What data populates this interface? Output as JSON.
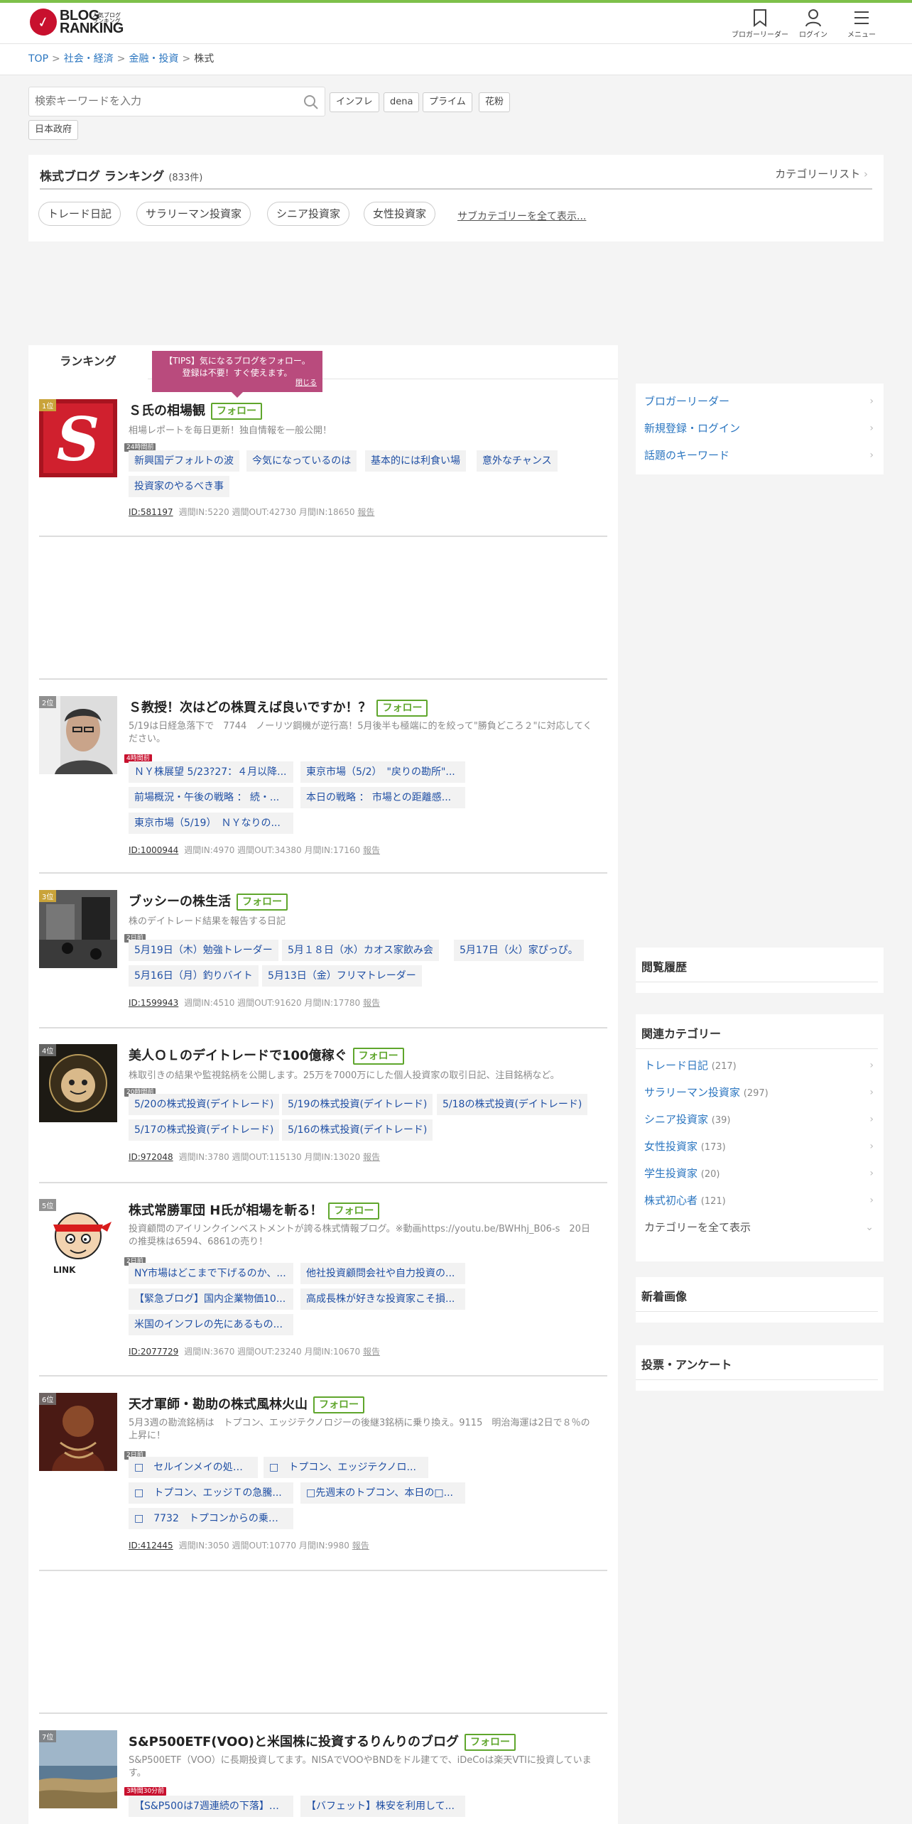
{
  "header": {
    "logo_line1": "BLOG",
    "logo_line2": "RANKING",
    "logo_sub": "人気ブログランキング",
    "nav": [
      {
        "label": "ブロガーリーダー",
        "icon": "bookmark-icon"
      },
      {
        "label": "ログイン",
        "icon": "user-icon"
      },
      {
        "label": "メニュー",
        "icon": "menu-icon"
      }
    ]
  },
  "breadcrumb": {
    "items": [
      "TOP",
      "社会・経済",
      "金融・投資"
    ],
    "current": "株式",
    "sep": ">"
  },
  "search": {
    "placeholder": "検索キーワードを入力",
    "keywords": [
      "インフレ",
      "dena",
      "プライム",
      "花粉",
      "日本政府"
    ]
  },
  "category": {
    "title": "株式ブログ ランキング",
    "count": "(833件)",
    "list_link": "カテゴリーリスト",
    "subcats": [
      "トレード日記",
      "サラリーマン投資家",
      "シニア投資家",
      "女性投資家"
    ],
    "all_sub": "サブカテゴリーを全て表示..."
  },
  "tabs": {
    "ranking": "ランキング"
  },
  "tips": {
    "line1": "【TIPS】気になるブログをフォロー。",
    "line2": "登録は不要！すぐ使えます。",
    "close": "閉じる"
  },
  "follow_label": "フォロー",
  "entries": [
    {
      "rank": "1位",
      "title": "Ｓ氏の相場観",
      "desc": "相場レポートを毎日更新！独自情報を一般公開！",
      "ago": "24時間前",
      "articles": [
        "新興国デフォルトの波",
        "今気になっているのは",
        "基本的には利食い場",
        "意外なチャンス",
        "投資家のやるべき事"
      ],
      "id": "ID:581197",
      "stats": "週間IN:5220 週間OUT:42730 月間IN:18650",
      "report": "報告"
    },
    {
      "rank": "2位",
      "title": "Ｓ教授！次はどの株買えば良いですか！？",
      "desc": "5/19は日経急落下で　7744　ノーリツ鋼機が逆行高！5月後半も極端に的を絞って\"勝負どころ２\"に対応してください。",
      "ago": "4時間前",
      "articles": [
        "ＮＹ株展望 5/23?27：４月以降...",
        "東京市場（5/2）　\"戻りの勘所\"...",
        "前場概況・午後の戦略 ： 続・...",
        "本日の戦略 ： 市場との距離感...",
        "東京市場（5/19）　ＮＹなりの..."
      ],
      "id": "ID:1000944",
      "stats": "週間IN:4970 週間OUT:34380 月間IN:17160",
      "report": "報告"
    },
    {
      "rank": "3位",
      "title": "ブッシーの株生活",
      "desc": "株のデイトレード結果を報告する日記",
      "ago": "2日前",
      "articles": [
        "5月19日（木）勉強トレーダー",
        "5月１８日（水）カオス家飲み会",
        "5月17日（火）家ぴっぴ。",
        "5月16日（月）釣りバイト",
        "5月13日（金）フリマトレーダー"
      ],
      "id": "ID:1599943",
      "stats": "週間IN:4510 週間OUT:91620 月間IN:17780",
      "report": "報告"
    },
    {
      "rank": "4位",
      "title": "美人ＯＬのデイトレードで100億稼ぐ",
      "desc": "株取引きの結果や監視銘柄を公開します。25万を7000万にした個人投資家の取引日記、注目銘柄など。",
      "ago": "20時間前",
      "articles": [
        "5/20の株式投資(デイトレード)",
        "5/19の株式投資(デイトレード)",
        "5/18の株式投資(デイトレード)",
        "5/17の株式投資(デイトレード)",
        "5/16の株式投資(デイトレード)"
      ],
      "id": "ID:972048",
      "stats": "週間IN:3780 週間OUT:115130 月間IN:13020",
      "report": "報告"
    },
    {
      "rank": "5位",
      "title": "株式常勝軍団 H氏が相場を斬る！",
      "desc": "投資顧問のアイリンクインベストメントが誇る株式情報ブログ。※動画https://youtu.be/BWHhj_B06-s　20日の推奨株は6594、6861の売り！",
      "ago": "2日前",
      "articles": [
        "NY市場はどこまで下げるのか、...",
        "他社投資顧問会社や自力投資の...",
        "【緊急ブログ】国内企業物価10...",
        "高成長株が好きな投資家こそ損...",
        "米国のインフレの先にあるもの..."
      ],
      "id": "ID:2077729",
      "stats": "週間IN:3670 週間OUT:23240 月間IN:10670",
      "report": "報告"
    },
    {
      "rank": "6位",
      "title": "天才軍師・勘助の株式風林火山",
      "desc": "5月3週の勘流銘柄は　トプコン、エッジテクノロジーの後継3銘柄に乗り換え。9115　明治海運は2日で８％の上昇に！",
      "ago": "2日前",
      "articles": [
        "□　セルインメイの処し方",
        "□　トプコン、エッジテクノロ...",
        "□　トプコン、エッジＴの急騰...",
        "□先週末のトプコン、本日の□...",
        "□　7732　トプコンからの乗り..."
      ],
      "id": "ID:412445",
      "stats": "週間IN:3050 週間OUT:10770 月間IN:9980",
      "report": "報告"
    },
    {
      "rank": "7位",
      "title": "S&P500ETF(VOO)と米国株に投資するりんりのブログ",
      "desc": "S&P500ETF（VOO）に長期投資してます。NISAでVOOやBNDをドル建てで、iDeCoは楽天VTIに投資しています。",
      "ago": "3時間30分前",
      "articles": [
        "【S&P500は7週連続の下落】週...",
        "【バフェット】株安を利用して..."
      ],
      "id": "",
      "stats": "",
      "report": ""
    }
  ],
  "sidebar": {
    "links": [
      "ブロガーリーダー",
      "新規登録・ログイン",
      "話題のキーワード"
    ],
    "history": "閲覧履歴",
    "related": "関連カテゴリー",
    "related_items": [
      {
        "label": "トレード日記",
        "count": "(217)"
      },
      {
        "label": "サラリーマン投資家",
        "count": "(297)"
      },
      {
        "label": "シニア投資家",
        "count": "(39)"
      },
      {
        "label": "女性投資家",
        "count": "(173)"
      },
      {
        "label": "学生投資家",
        "count": "(20)"
      },
      {
        "label": "株式初心者",
        "count": "(121)"
      }
    ],
    "show_all": "カテゴリーを全て表示",
    "new_images": "新着画像",
    "vote": "投票・アンケート"
  },
  "colors": {
    "accent_green": "#5fa62c",
    "link_blue": "#2b76c0",
    "brand_red": "#c8102e",
    "tips_bg": "#b94b7d"
  }
}
